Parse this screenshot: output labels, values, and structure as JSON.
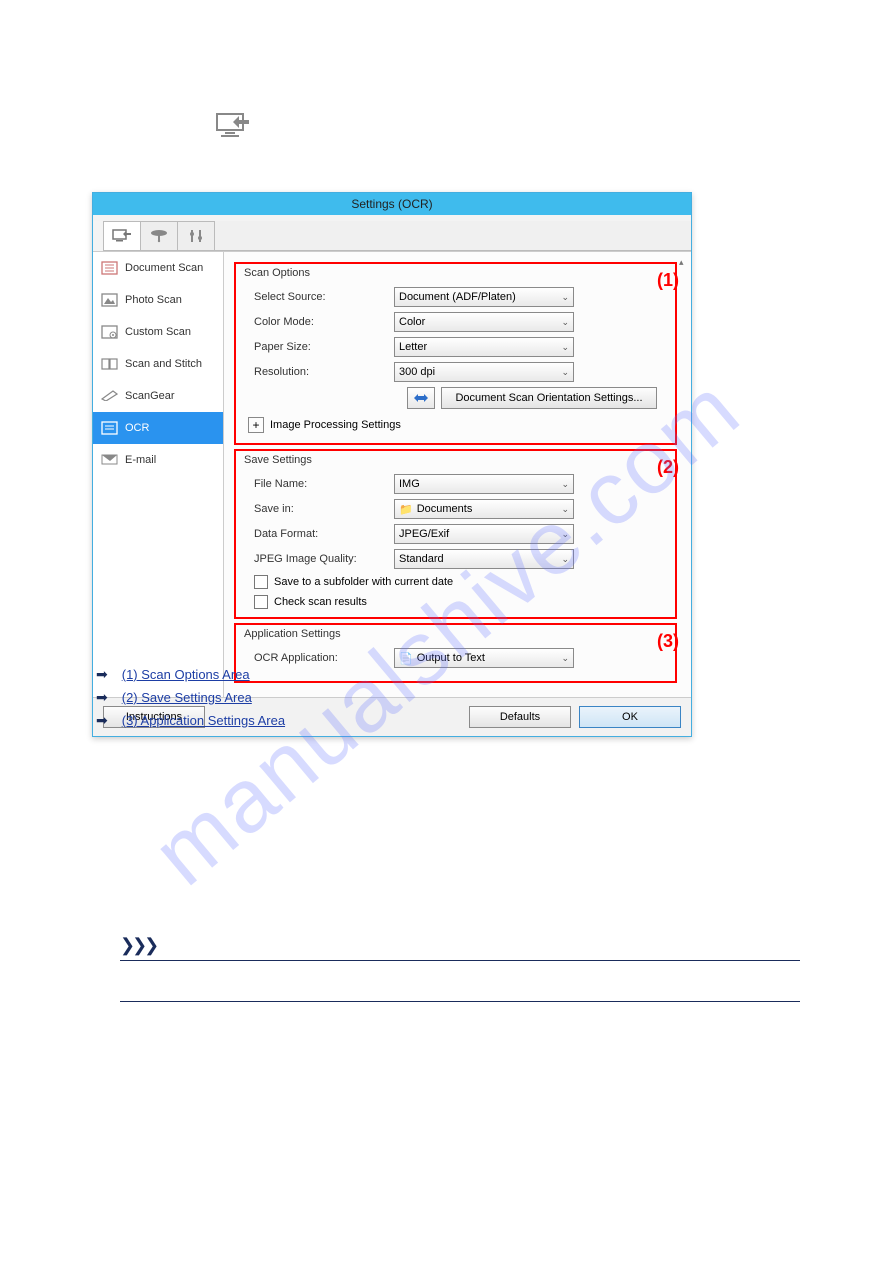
{
  "title": "Settings (OCR)",
  "tabs_icons": [
    "monitor-arrow-icon",
    "platform-icon",
    "sliders-icon"
  ],
  "sidebar": [
    {
      "icon": "document-scan-icon",
      "label": "Document Scan"
    },
    {
      "icon": "photo-scan-icon",
      "label": "Photo Scan"
    },
    {
      "icon": "custom-scan-icon",
      "label": "Custom Scan"
    },
    {
      "icon": "scan-stitch-icon",
      "label": "Scan and Stitch"
    },
    {
      "icon": "scangear-icon",
      "label": "ScanGear"
    },
    {
      "icon": "ocr-icon",
      "label": "OCR"
    },
    {
      "icon": "email-icon",
      "label": "E-mail"
    }
  ],
  "groups": {
    "scan": {
      "title": "Scan Options",
      "callout": "(1)",
      "source_label": "Select Source:",
      "source_value": "Document (ADF/Platen)",
      "color_label": "Color Mode:",
      "color_value": "Color",
      "paper_label": "Paper Size:",
      "paper_value": "Letter",
      "res_label": "Resolution:",
      "res_value": "300 dpi",
      "orient_btn": "Document Scan Orientation Settings...",
      "expand_label": "Image Processing Settings"
    },
    "save": {
      "title": "Save Settings",
      "callout": "(2)",
      "file_label": "File Name:",
      "file_value": "IMG",
      "savein_label": "Save in:",
      "savein_value": "Documents",
      "fmt_label": "Data Format:",
      "fmt_value": "JPEG/Exif",
      "qual_label": "JPEG Image Quality:",
      "qual_value": "Standard",
      "chk1": "Save to a subfolder with current date",
      "chk2": "Check scan results"
    },
    "app": {
      "title": "Application Settings",
      "callout": "(3)",
      "ocr_label": "OCR Application:",
      "ocr_value": "Output to Text"
    }
  },
  "buttons": {
    "instructions": "Instructions",
    "defaults": "Defaults",
    "ok": "OK"
  },
  "links": {
    "l1": "(1) Scan Options Area",
    "l2": "(2) Save Settings Area",
    "l3": "(3) Application Settings Area"
  },
  "watermark": "manualshive.com",
  "note_marker": "❯❯❯"
}
